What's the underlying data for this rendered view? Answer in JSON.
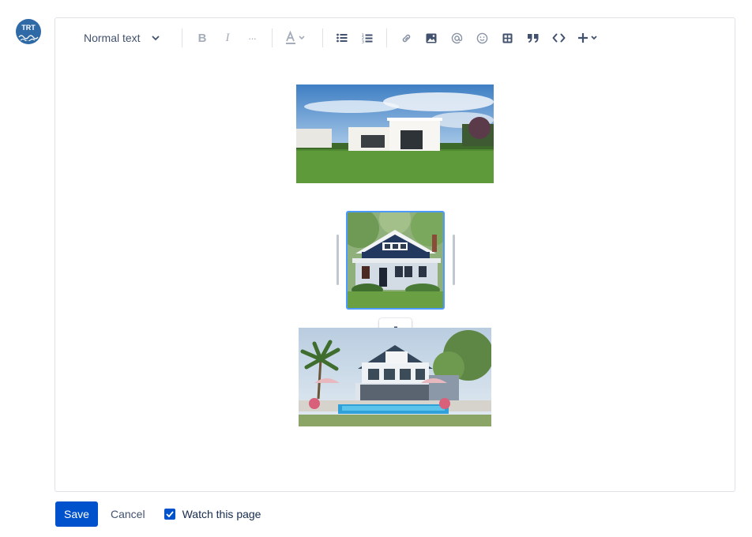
{
  "user": {
    "avatar_initials": "TRT"
  },
  "toolbar": {
    "text_style": "Normal text",
    "items": [
      {
        "name": "bold-icon",
        "glyph": "B",
        "disabled": true
      },
      {
        "name": "italic-icon",
        "glyph": "I",
        "disabled": true
      },
      {
        "name": "more-formatting-icon",
        "glyph": "···",
        "disabled": true
      }
    ]
  },
  "images": [
    {
      "alt": "Modern white house with lawn"
    },
    {
      "alt": "Blue craftsman house"
    },
    {
      "alt": "House with pool and palm trees"
    }
  ],
  "footer": {
    "save_label": "Save",
    "cancel_label": "Cancel",
    "watch_label": "Watch this page",
    "watch_checked": true
  },
  "colors": {
    "primary": "#0052cc",
    "selection": "#4c9aff",
    "text": "#172b4d",
    "muted": "#42526e",
    "disabled": "#a5adba"
  }
}
